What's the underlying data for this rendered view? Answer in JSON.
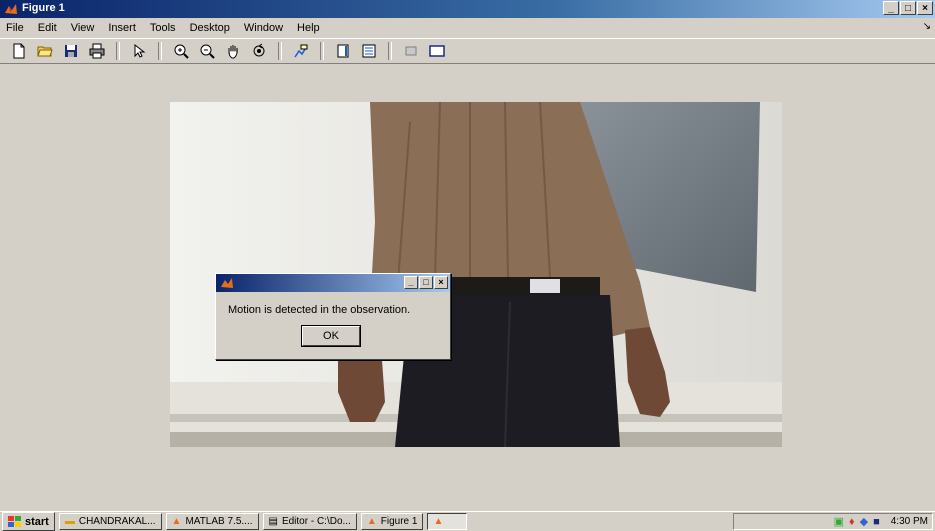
{
  "window": {
    "title": "Figure 1",
    "controls": {
      "minimize": "_",
      "maximize": "□",
      "close": "×"
    }
  },
  "menu": {
    "items": [
      "File",
      "Edit",
      "View",
      "Insert",
      "Tools",
      "Desktop",
      "Window",
      "Help"
    ]
  },
  "toolbar": {
    "icons": [
      "new-figure-icon",
      "open-file-icon",
      "save-icon",
      "print-icon",
      "edit-plot-arrow-icon",
      "zoom-in-icon",
      "zoom-out-icon",
      "pan-hand-icon",
      "rotate-3d-icon",
      "data-cursor-icon",
      "insert-colorbar-icon",
      "insert-legend-icon",
      "hide-plot-tools-icon",
      "show-plot-tools-icon"
    ]
  },
  "dialog": {
    "title": "",
    "message": "Motion is detected in the observation.",
    "ok_label": "OK",
    "controls": {
      "minimize": "_",
      "maximize": "□",
      "close": "×"
    }
  },
  "taskbar": {
    "start_label": "start",
    "tasks": [
      {
        "label": "CHANDRAKAL...",
        "icon": "folder-icon"
      },
      {
        "label": "MATLAB 7.5....",
        "icon": "matlab-icon"
      },
      {
        "label": "Editor - C:\\Do...",
        "icon": "editor-icon"
      },
      {
        "label": "Figure 1",
        "icon": "matlab-figure-icon"
      }
    ],
    "clock": "4:30 PM"
  },
  "colors": {
    "title_gradient_start": "#0a246a",
    "title_gradient_end": "#a6caf0",
    "face": "#d4d0c8"
  }
}
